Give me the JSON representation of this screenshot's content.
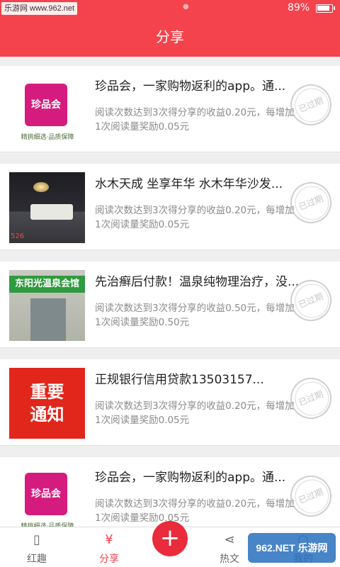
{
  "status": {
    "watermark": "乐游网 www.962.net",
    "battery_text": "89%",
    "battery_level": 0.89
  },
  "nav": {
    "title": "分享"
  },
  "stamp_label": "已过期",
  "items": [
    {
      "title": "珍品会，一家购物返利的app。通...",
      "desc1": "阅读次数达到3次得分享的收益0.20元，每增加",
      "desc2": "1次阅读量奖励0.05元",
      "thumb": {
        "kind": "logo",
        "logo": "珍品会",
        "tag": "精挑细选·品质保障"
      }
    },
    {
      "title": "水木天成 坐享年华 水木年华沙发...",
      "desc1": "阅读次数达到3次得分享的收益0.20元，每增加",
      "desc2": "1次阅读量奖励0.05元",
      "thumb": {
        "kind": "sofa",
        "num": "526"
      }
    },
    {
      "title": "先治癣后付款！温泉纯物理治疗，没...",
      "desc1": "阅读次数达到3次得分享的收益0.50元，每增加",
      "desc2": "1次阅读量奖励0.50元",
      "thumb": {
        "kind": "spa",
        "sign": "东阳光温泉会馆"
      }
    },
    {
      "title": "正规银行信用贷款13503157...",
      "desc1": "阅读次数达到3次得分享的收益0.20元，每增加",
      "desc2": "1次阅读量奖励0.05元",
      "thumb": {
        "kind": "notice",
        "line1": "重要",
        "line2": "通知"
      }
    },
    {
      "title": "珍品会，一家购物返利的app。通...",
      "desc1": "阅读次数达到3次得分享的收益0.20元，每增加",
      "desc2": "1次阅读量奖励0.05元",
      "thumb": {
        "kind": "logo",
        "logo": "珍品会",
        "tag": "精挑细选·品质保障"
      }
    }
  ],
  "tabbar": {
    "tabs": [
      {
        "label": "红趣",
        "icon": "red-packet-icon",
        "glyph": "▯"
      },
      {
        "label": "分享",
        "icon": "money-bag-icon",
        "glyph": "¥"
      },
      {
        "label": "",
        "icon": "plus-icon",
        "glyph": "+"
      },
      {
        "label": "热文",
        "icon": "share-icon",
        "glyph": "⋖"
      },
      {
        "label": "我的",
        "icon": "user-icon",
        "glyph": "○"
      }
    ],
    "active_index": 1,
    "watermark": "962.NET 乐游网"
  }
}
